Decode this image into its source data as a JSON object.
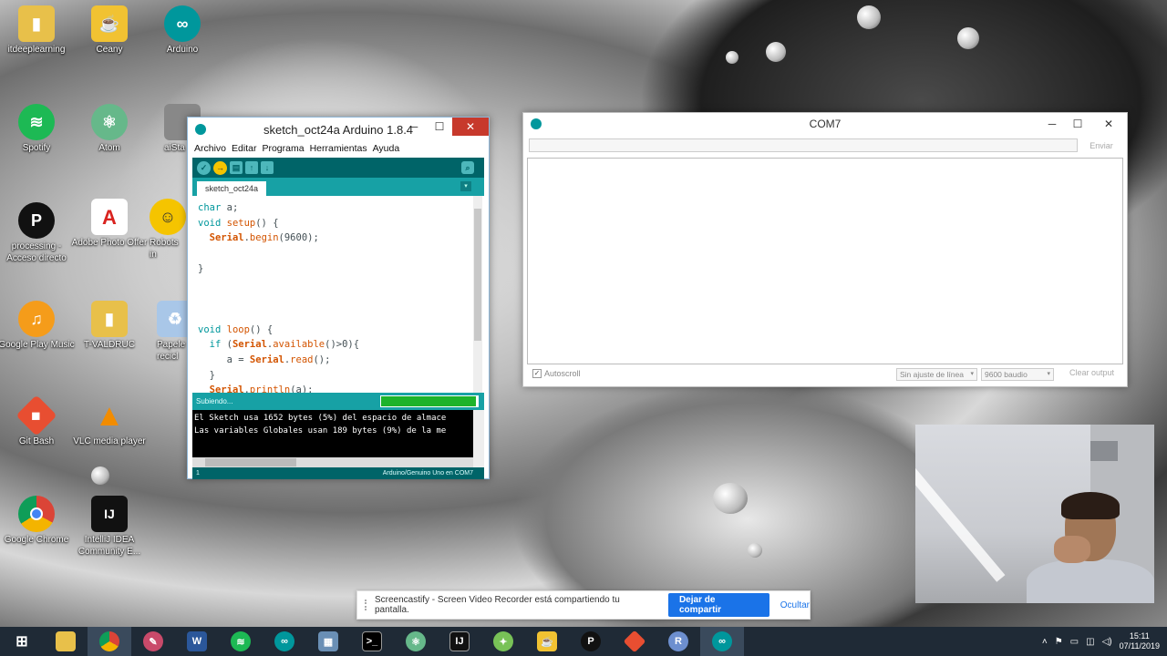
{
  "desktop": {
    "icons": [
      {
        "label": "itdeeplearning",
        "icon": "folder-icon",
        "color": "#e8c04a"
      },
      {
        "label": "Ceany",
        "icon": "teapot-icon",
        "color": "#f1c232"
      },
      {
        "label": "Arduino",
        "icon": "arduino-icon",
        "color": "#00979c"
      },
      {
        "label": "Spotify",
        "icon": "spotify-icon",
        "color": "#1db954"
      },
      {
        "label": "Atom",
        "icon": "atom-icon",
        "color": "#66b88a"
      },
      {
        "label": "aiSta",
        "icon": "app-icon",
        "color": "#888888"
      },
      {
        "label": "processing - Acceso directo",
        "icon": "processing-icon",
        "color": "#111111"
      },
      {
        "label": "Adobe Photo Offer",
        "icon": "adobe-icon",
        "color": "#ffffff"
      },
      {
        "label": "Robots in",
        "icon": "robot-icon",
        "color": "#f5c400"
      },
      {
        "label": "Google Play Music",
        "icon": "headphones-icon",
        "color": "#f59c1a"
      },
      {
        "label": "T-VALDRUC",
        "icon": "folder-icon",
        "color": "#e8c04a"
      },
      {
        "label": "Papele recicl",
        "icon": "recycle-bin-icon",
        "color": "#a9c7e8"
      },
      {
        "label": "Git Bash",
        "icon": "git-icon",
        "color": "#e84e31"
      },
      {
        "label": "VLC media player",
        "icon": "vlc-icon",
        "color": "#f28c00"
      },
      {
        "label": "Google Chrome",
        "icon": "chrome-icon",
        "color": "#4285f4"
      },
      {
        "label": "IntelliJ IDEA Community E...",
        "icon": "intellij-icon",
        "color": "#111111"
      }
    ]
  },
  "ide": {
    "title": "sketch_oct24a Arduino 1.8.4",
    "menu": [
      "Archivo",
      "Editar",
      "Programa",
      "Herramientas",
      "Ayuda"
    ],
    "tab": "sketch_oct24a",
    "status": "Subiendo...",
    "upload_progress": 0.98,
    "console_lines": [
      "El Sketch usa 1652 bytes (5%) del espacio de almace",
      "Las variables Globales usan 189 bytes (9%) de la me"
    ],
    "footer_line": "1",
    "footer_board": "Arduino/Genuino Uno en COM7"
  },
  "serial": {
    "title": "COM7",
    "send": "Enviar",
    "autoscroll": "Autoscroll",
    "line_ending": "Sin ajuste de línea",
    "baud": "9600 baudio",
    "clear": "Clear output"
  },
  "castbar": {
    "message": "Screencastify - Screen Video Recorder está compartiendo tu pantalla.",
    "stop": "Dejar de compartir",
    "hide": "Ocultar"
  },
  "taskbar": {
    "time": "15:11",
    "date": "07/11/2019"
  }
}
